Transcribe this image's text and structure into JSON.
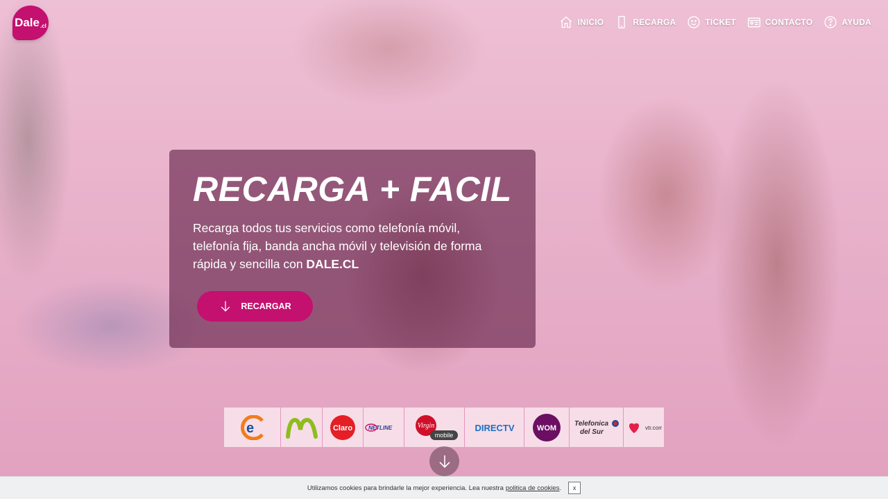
{
  "brand": {
    "logo_text": "Dale",
    "logo_suffix": ".cl",
    "accent": "#c4106f"
  },
  "nav": {
    "items": [
      {
        "label": "INICIO",
        "icon": "home-icon"
      },
      {
        "label": "RECARGA",
        "icon": "phone-icon"
      },
      {
        "label": "TICKET",
        "icon": "smiley-icon"
      },
      {
        "label": "CONTACTO",
        "icon": "contact-card-icon"
      },
      {
        "label": "AYUDA",
        "icon": "help-icon"
      }
    ]
  },
  "hero": {
    "title": "RECARGA + FACIL",
    "description_prefix": "Recarga todos tus servicios como telefonía móvil, telefonía fija, banda ancha móvil y televisión de forma rápida y sencilla con ",
    "description_brand": "DALE.CL",
    "cta_label": "RECARGAR",
    "cta_icon": "arrow-down-icon"
  },
  "operators": [
    {
      "name": "entel",
      "label": "e"
    },
    {
      "name": "movistar",
      "label": "M"
    },
    {
      "name": "claro",
      "label": "Claro"
    },
    {
      "name": "netline",
      "label": "NETLINE"
    },
    {
      "name": "virgin-mobile",
      "label": "Virgin mobile"
    },
    {
      "name": "directv",
      "label": "DIRECTV"
    },
    {
      "name": "wom",
      "label": "WOM"
    },
    {
      "name": "telefonica-del-sur",
      "label": "Telefonica del Sur"
    },
    {
      "name": "vtr",
      "label": "vtr.com"
    }
  ],
  "scroll": {
    "icon": "arrow-down-icon"
  },
  "cookie": {
    "text": "Utilizamos cookies para brindarle la mejor experiencia. Lea nuestra",
    "link": "politica de cookies",
    "close": "x"
  }
}
